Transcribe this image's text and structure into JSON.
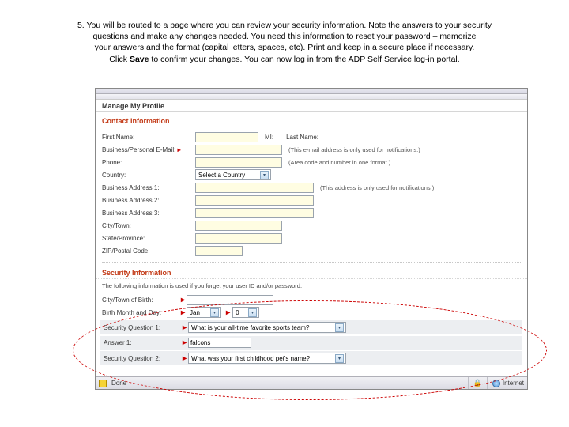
{
  "instruction": {
    "num": "5.",
    "line1": "You will be routed to a page where you can review your security information. Note the answers to your security",
    "line2": "questions and make any changes needed.  You need this information to reset your password – memorize",
    "line3": "your answers and the format (capital letters, spaces, etc). Print and keep in a secure place if necessary.",
    "line4a": "Click ",
    "line4b": "Save",
    "line4c": " to confirm your changes. You can now log in from the ADP Self Service log-in portal."
  },
  "screenshot": {
    "title": "Manage My Profile",
    "contactHeader": "Contact Information",
    "labels": {
      "firstName": "First Name:",
      "mi": "MI:",
      "lastName": "Last Name:",
      "email": "Business/Personal E-Mail:",
      "phone": "Phone:",
      "country": "Country:",
      "addr1": "Business Address 1:",
      "addr2": "Business Address 2:",
      "addr3": "Business Address 3:",
      "city": "City/Town:",
      "state": "State/Province:",
      "zip": "ZIP/Postal Code:"
    },
    "notes": {
      "email": "(This e-mail address is only used for notifications.)",
      "phone": "(Area code and number in one format.)",
      "addr": "(This address is only used for notifications.)"
    },
    "country": "Select a Country",
    "securityHeader": "Security Information",
    "securityDesc": "The following information is used if you forget your user ID and/or password.",
    "secLabels": {
      "cityBirth": "City/Town of Birth:",
      "birthMD": "Birth Month and Day:",
      "q1": "Security Question 1:",
      "a1": "Answer 1:",
      "q2": "Security Question 2:"
    },
    "secValues": {
      "monthSel": "Jan",
      "daySel": "0",
      "q1": "What is your all-time favorite sports team?",
      "a1": "falcons",
      "q2": "What was your first childhood pet's name?"
    },
    "status": {
      "done": "Done",
      "zone": "Internet"
    }
  }
}
